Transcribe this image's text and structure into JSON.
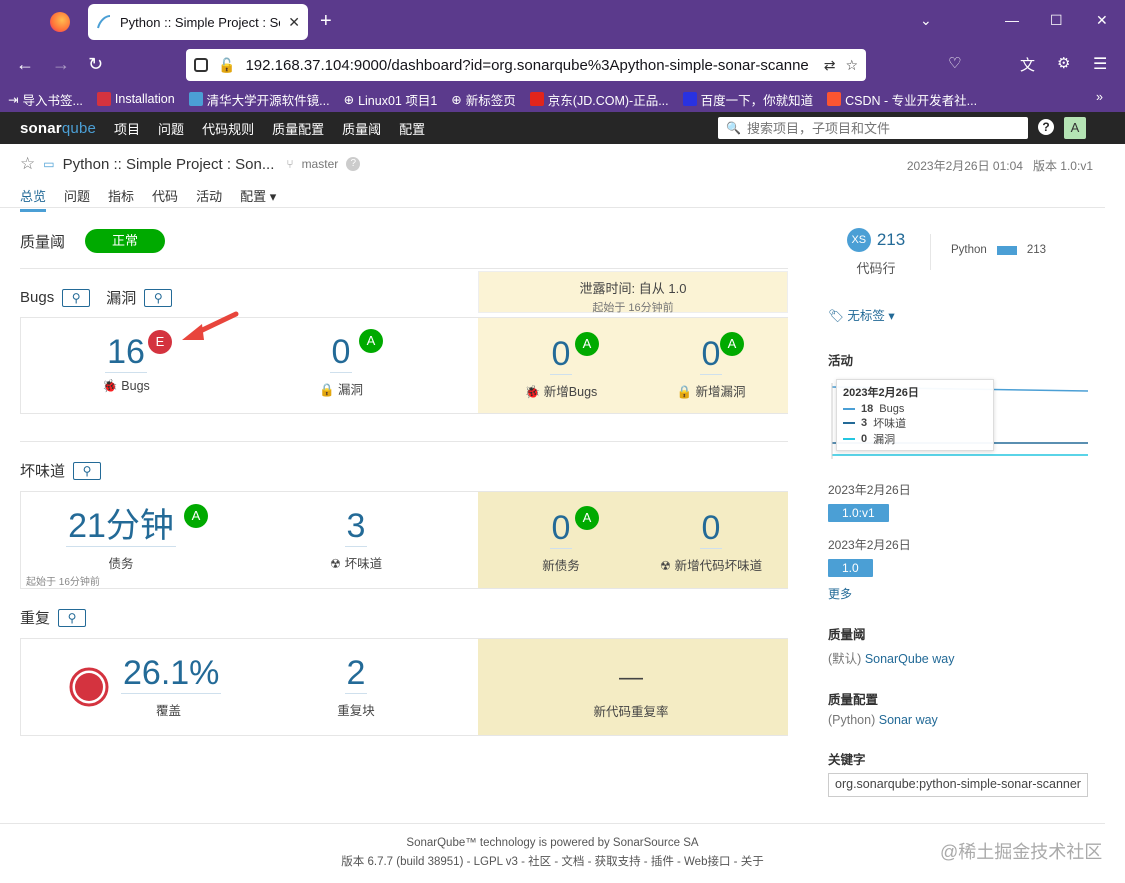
{
  "browser": {
    "tab_title": "Python :: Simple Project : Son",
    "url": "192.168.37.104:9000/dashboard?id=org.sonarqube%3Apython-simple-sonar-scanne",
    "bookmarks": [
      "导入书签...",
      "Installation",
      "清华大学开源软件镜...",
      "Linux01 项目1",
      "新标签页",
      "京东(JD.COM)-正品...",
      "百度一下，你就知道",
      "CSDN - 专业开发者社..."
    ]
  },
  "sonar": {
    "logo_a": "sonar",
    "logo_b": "qube",
    "menu": [
      "项目",
      "问题",
      "代码规则",
      "质量配置",
      "质量阈",
      "配置"
    ],
    "search_placeholder": "搜索项目，子项目和文件",
    "avatar": "A"
  },
  "project": {
    "title": "Python :: Simple Project : Son...",
    "branch": "master",
    "date": "2023年2月26日 01:04",
    "version": "版本 1.0:v1",
    "tabs": [
      "总览",
      "问题",
      "指标",
      "代码",
      "活动",
      "配置 ▾"
    ]
  },
  "quality_gate": {
    "label": "质量阈",
    "status": "正常",
    "status_color": "#00aa00"
  },
  "leak": {
    "title": "泄露时间: 自从 1.0",
    "since": "起始于 16分钟前"
  },
  "reliability": {
    "bugs_label": "Bugs",
    "vuln_label": "漏洞",
    "bugs": "16",
    "bugs_rating": "E",
    "vulns": "0",
    "vulns_rating": "A",
    "bugs_metric_label": "Bugs",
    "vulns_metric_label": "漏洞",
    "new_bugs": "0",
    "new_bugs_rating": "A",
    "new_bugs_label": "新增Bugs",
    "new_vulns": "0",
    "new_vulns_rating": "A",
    "new_vulns_label": "新增漏洞"
  },
  "maintainability": {
    "label": "坏味道",
    "debt": "21分钟",
    "debt_rating": "A",
    "debt_label": "债务",
    "debt_since": "起始于 16分钟前",
    "smells": "3",
    "smells_label": "坏味道",
    "new_debt": "0",
    "new_debt_rating": "A",
    "new_debt_label": "新债务",
    "new_smells": "0",
    "new_smells_label": "新增代码坏味道"
  },
  "duplications": {
    "label": "重复",
    "coverage": "26.1%",
    "coverage_label": "覆盖",
    "blocks": "2",
    "blocks_label": "重复块",
    "new_dup": "—",
    "new_dup_label": "新代码重复率"
  },
  "sidebar": {
    "size": "XS",
    "lines": "213",
    "lines_label": "代码行",
    "lang_name": "Python",
    "lang_lines": "213",
    "tags": "无标签",
    "activity_title": "活动",
    "tooltip": {
      "date": "2023年2月26日",
      "bugs": "18",
      "bugs_label": "Bugs",
      "smells": "3",
      "smells_label": "坏味道",
      "vulns": "0",
      "vulns_label": "漏洞"
    },
    "events": [
      {
        "date": "2023年2月26日",
        "version": "1.0:v1"
      },
      {
        "date": "2023年2月26日",
        "version": "1.0"
      }
    ],
    "more": "更多",
    "qg_title": "质量阈",
    "qg_default": "(默认)",
    "qg_value": "SonarQube way",
    "qp_title": "质量配置",
    "qp_lang": "(Python)",
    "qp_value": "Sonar way",
    "key_title": "关键字",
    "key_value": "org.sonarqube:python-simple-sonar-scanner"
  },
  "footer": {
    "line1": "SonarQube™ technology is powered by SonarSource SA",
    "line2": "版本 6.7.7 (build 38951) - LGPL v3 - 社区 - 文档 - 获取支持 - 插件 - Web接口 - 关于"
  },
  "watermark": "@稀土掘金技术社区"
}
